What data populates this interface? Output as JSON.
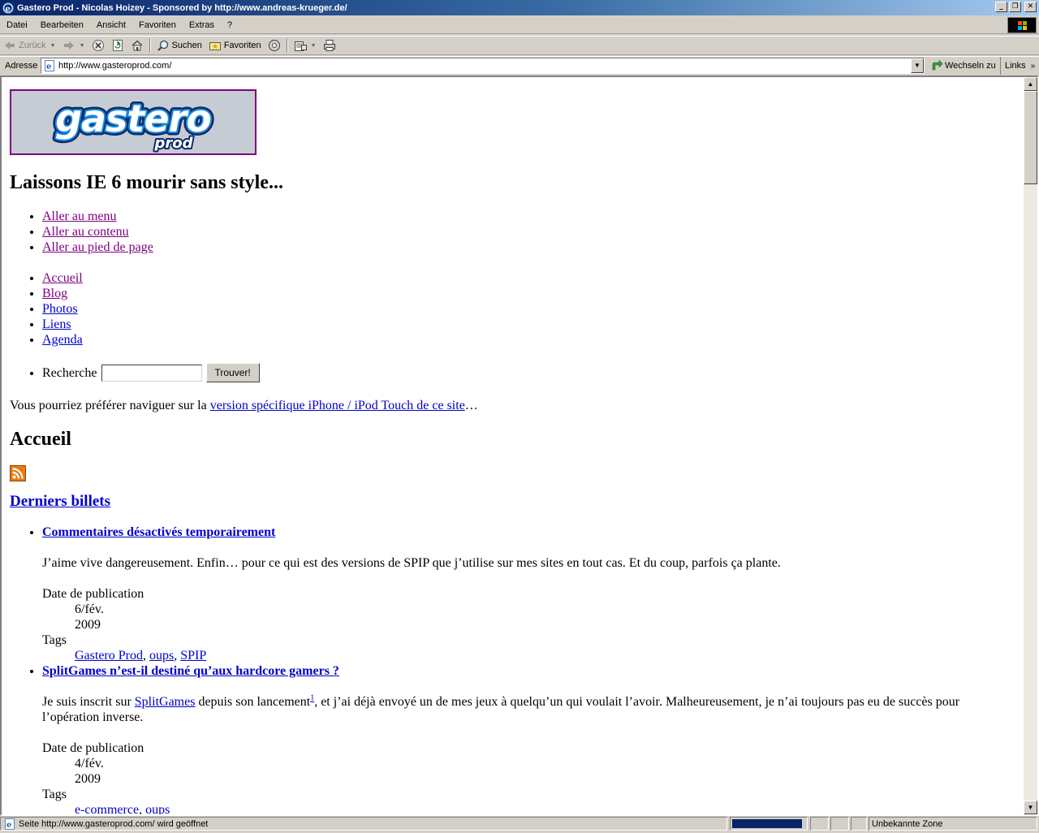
{
  "window": {
    "title": "Gastero Prod - Nicolas Hoizey - Sponsored by http://www.andreas-krueger.de/"
  },
  "menu": [
    "Datei",
    "Bearbeiten",
    "Ansicht",
    "Favoriten",
    "Extras",
    "?"
  ],
  "toolbar": {
    "back_label": "Zurück",
    "search_label": "Suchen",
    "favorites_label": "Favoriten"
  },
  "address": {
    "label": "Adresse",
    "url": "http://www.gasteroprod.com/",
    "go_label": "Wechseln zu",
    "links_label": "Links"
  },
  "page": {
    "logo_text": "Gastero prod",
    "site_title": "Laissons IE 6 mourir sans style...",
    "skip_links": [
      "Aller au menu",
      "Aller au contenu",
      "Aller au pied de page"
    ],
    "nav": [
      "Accueil",
      "Blog",
      "Photos",
      "Liens",
      "Agenda"
    ],
    "search_label": "Recherche",
    "search_button": "Trouver!",
    "iphone_prefix": "Vous pourriez préférer naviguer sur la ",
    "iphone_link": "version spécifique iPhone / iPod Touch de ce site",
    "iphone_suffix": "…",
    "section_title": "Accueil",
    "latest_title": "Derniers billets",
    "posts": [
      {
        "title": "Commentaires désactivés temporairement",
        "excerpt": "J’aime vive dangereusement. Enfin… pour ce qui est des versions de SPIP que j’utilise sur mes sites en tout cas. Et du coup, parfois ça plante.",
        "date_label": "Date de publication",
        "date_day": "6/fév.",
        "date_year": "2009",
        "tags_label": "Tags",
        "tags": [
          "Gastero Prod",
          "oups",
          "SPIP"
        ]
      },
      {
        "title": "SplitGames n’est-il destiné qu’aux hardcore gamers ?",
        "excerpt_prefix": "Je suis inscrit sur ",
        "excerpt_link": "SplitGames",
        "excerpt_mid": " depuis son lancement",
        "excerpt_note": "1",
        "excerpt_suffix": ", et j’ai déjà envoyé un de mes jeux à quelqu’un qui voulait l’avoir. Malheureusement, je n’ai toujours pas eu de succès pour l’opération inverse.",
        "date_label": "Date de publication",
        "date_day": "4/fév.",
        "date_year": "2009",
        "tags_label": "Tags",
        "tags": [
          "e-commerce",
          "oups"
        ]
      }
    ]
  },
  "status": {
    "text": "Seite http://www.gasteroprod.com/ wird geöffnet",
    "zone": "Unbekannte Zone",
    "progress_fraction": 0.95
  },
  "colors": {
    "title_gradient_start": "#0a246a",
    "link": "#0000cc",
    "visited_link": "#800080",
    "logo_blue": "#1a6fd0"
  }
}
